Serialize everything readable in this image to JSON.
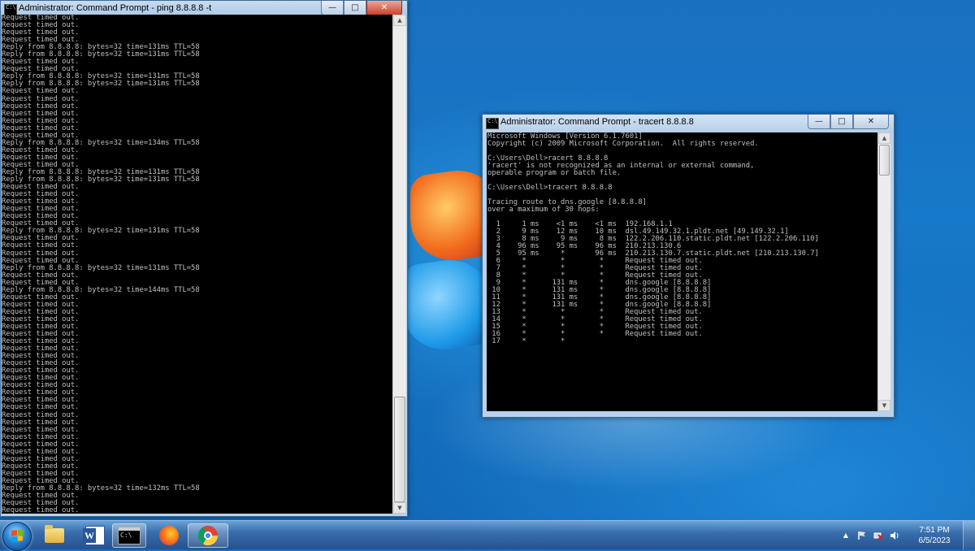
{
  "ping_window": {
    "title": "Administrator: Command Prompt - ping  8.8.8.8 -t",
    "minimize": "—",
    "maximize": "□",
    "close": "✕",
    "lines": [
      "Request timed out.",
      "Request timed out.",
      "Request timed out.",
      "Request timed out.",
      "Reply from 8.8.8.8: bytes=32 time=131ms TTL=58",
      "Reply from 8.8.8.8: bytes=32 time=131ms TTL=58",
      "Request timed out.",
      "Request timed out.",
      "Reply from 8.8.8.8: bytes=32 time=131ms TTL=58",
      "Reply from 8.8.8.8: bytes=32 time=131ms TTL=58",
      "Request timed out.",
      "Request timed out.",
      "Request timed out.",
      "Request timed out.",
      "Request timed out.",
      "Request timed out.",
      "Request timed out.",
      "Reply from 8.8.8.8: bytes=32 time=134ms TTL=58",
      "Request timed out.",
      "Request timed out.",
      "Request timed out.",
      "Reply from 8.8.8.8: bytes=32 time=131ms TTL=58",
      "Reply from 8.8.8.8: bytes=32 time=131ms TTL=58",
      "Request timed out.",
      "Request timed out.",
      "Request timed out.",
      "Request timed out.",
      "Request timed out.",
      "Request timed out.",
      "Reply from 8.8.8.8: bytes=32 time=131ms TTL=58",
      "Request timed out.",
      "Request timed out.",
      "Request timed out.",
      "Request timed out.",
      "Reply from 8.8.8.8: bytes=32 time=131ms TTL=58",
      "Request timed out.",
      "Request timed out.",
      "Reply from 8.8.8.8: bytes=32 time=144ms TTL=58",
      "Request timed out.",
      "Request timed out.",
      "Request timed out.",
      "Request timed out.",
      "Request timed out.",
      "Request timed out.",
      "Request timed out.",
      "Request timed out.",
      "Request timed out.",
      "Request timed out.",
      "Request timed out.",
      "Request timed out.",
      "Request timed out.",
      "Request timed out.",
      "Request timed out.",
      "Request timed out.",
      "Request timed out.",
      "Request timed out.",
      "Request timed out.",
      "Request timed out.",
      "Request timed out.",
      "Request timed out.",
      "Request timed out.",
      "Request timed out.",
      "Request timed out.",
      "Request timed out.",
      "Reply from 8.8.8.8: bytes=32 time=132ms TTL=58",
      "Request timed out.",
      "Request timed out.",
      "Request timed out."
    ]
  },
  "tracert_window": {
    "title": "Administrator: Command Prompt - tracert  8.8.8.8",
    "minimize": "—",
    "maximize": "□",
    "close": "✕",
    "lines": [
      "Microsoft Windows [Version 6.1.7601]",
      "Copyright (c) 2009 Microsoft Corporation.  All rights reserved.",
      "",
      "C:\\Users\\Dell>racert 8.8.8.8",
      "'racert' is not recognized as an internal or external command,",
      "operable program or batch file.",
      "",
      "C:\\Users\\Dell>tracert 8.8.8.8",
      "",
      "Tracing route to dns.google [8.8.8.8]",
      "over a maximum of 30 hops:",
      "",
      "  1     1 ms    <1 ms    <1 ms  192.168.1.1",
      "  2     9 ms    12 ms    10 ms  dsl.49.149.32.1.pldt.net [49.149.32.1]",
      "  3     8 ms     9 ms     8 ms  122.2.206.110.static.pldt.net [122.2.206.110]",
      "  4    96 ms    95 ms    96 ms  210.213.130.6",
      "  5    95 ms     *       96 ms  210.213.130.7.static.pldt.net [210.213.130.7]",
      "  6     *        *        *     Request timed out.",
      "  7     *        *        *     Request timed out.",
      "  8     *        *        *     Request timed out.",
      "  9     *      131 ms     *     dns.google [8.8.8.8]",
      " 10     *      131 ms     *     dns.google [8.8.8.8]",
      " 11     *      131 ms     *     dns.google [8.8.8.8]",
      " 12     *      131 ms     *     dns.google [8.8.8.8]",
      " 13     *        *        *     Request timed out.",
      " 14     *        *        *     Request timed out.",
      " 15     *        *        *     Request timed out.",
      " 16     *        *        *     Request timed out.",
      " 17     *        *"
    ]
  },
  "taskbar": {
    "word_label": "W",
    "cmd_label": "C:\\",
    "tray_arrow": "▲",
    "clock_time": "7:51 PM",
    "clock_date": "6/5/2023"
  }
}
